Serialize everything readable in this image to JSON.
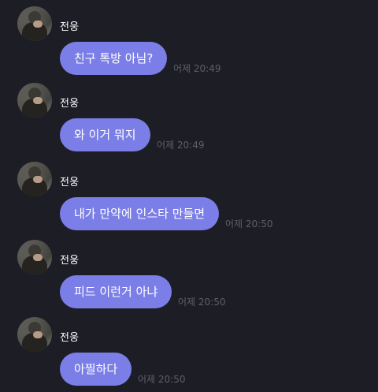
{
  "messages": [
    {
      "sender": "전웅",
      "text": "친구 톡방 아님?",
      "time": "어제 20:49"
    },
    {
      "sender": "전웅",
      "text": "와 이거 뭐지",
      "time": "어제 20:49"
    },
    {
      "sender": "전웅",
      "text": "내가 만약에 인스타 만들면",
      "time": "어제 20:50"
    },
    {
      "sender": "전웅",
      "text": "피드 이런거 아냐",
      "time": "어제 20:50"
    },
    {
      "sender": "전웅",
      "text": "아찔하다",
      "time": "어제 20:50"
    }
  ],
  "colors": {
    "background": "#1d1d26",
    "bubble": "#7b7ee6",
    "timestamp": "#5d5f6b"
  }
}
